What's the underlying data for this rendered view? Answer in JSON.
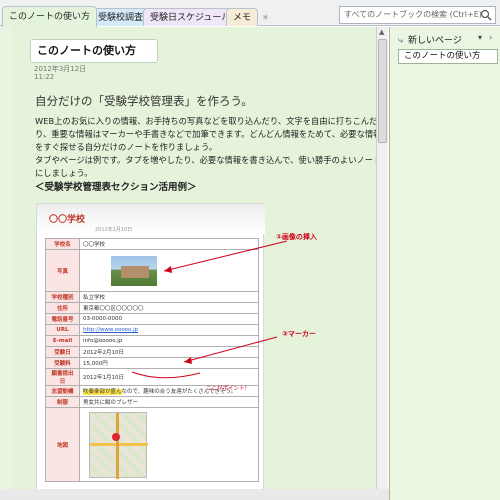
{
  "tabs": [
    {
      "label": "このノートの使い方",
      "active": true
    },
    {
      "label": "受験校調査",
      "active": false
    },
    {
      "label": "受験日スケジュール",
      "active": false
    },
    {
      "label": "メモ",
      "active": false
    }
  ],
  "search": {
    "placeholder": "すべてのノートブックの検索 (Ctrl+E)"
  },
  "page": {
    "title": "このノートの使い方",
    "date": "2012年3月12日",
    "time": "11:22",
    "heading": "自分だけの「受験学校管理表」を作ろう。",
    "paragraph1": "WEB上のお気に入りの情報、お手持ちの写真などを取り込んだり、文字を自由に打ちこんだり、重要な情報はマーカーや手書きなどで加筆できます。どんどん情報をためて、必要な情報をすぐ探せる自分だけのノートを作りましょう。",
    "paragraph2": "タブやページは例です。タブを増やしたり、必要な情報を書き込んで、使い勝手のよいノートにしましょう。",
    "subheading": "＜受験学校管理表セクション活用例＞"
  },
  "example_sheet": {
    "title": "〇〇学校",
    "subtitle": "2012年1月10日",
    "rows": [
      {
        "key": "学校名",
        "value": "〇〇学校"
      },
      {
        "key": "写真",
        "value": ""
      },
      {
        "key": "学校種別",
        "value": "私立学校"
      },
      {
        "key": "住所",
        "value": "東京都〇〇区〇〇〇〇〇"
      },
      {
        "key": "電話番号",
        "value": "03-0000-0000"
      },
      {
        "key": "URL",
        "value": "http://www.ooooo.jp"
      },
      {
        "key": "E-mail",
        "value": "info@ooooo.jp"
      },
      {
        "key": "受験日",
        "value": "2012年2月10日"
      },
      {
        "key": "受験料",
        "value": "15,000円"
      },
      {
        "key": "願書提出日",
        "value": "2012年1月10日"
      },
      {
        "key": "志望動機",
        "value_highlight": "吹奏楽部が盛ん",
        "value_rest": "なので、趣味の合う友達がたくさんできそう。"
      },
      {
        "key": "制服",
        "value": "男女共に紺のブレザー"
      },
      {
        "key": "地図",
        "value": ""
      }
    ],
    "annotations": {
      "image_insert": "①画像の挿入",
      "marker": "②マーカー",
      "point": "ここがポイント！"
    }
  },
  "side_panel": {
    "new_page": "新しいページ",
    "pages": [
      "このノートの使い方"
    ]
  },
  "colors": {
    "active_tab": "#e4f4dc",
    "page_bg": "#e4f3da",
    "annotation": "#d0021b",
    "highlight": "#ffe84a"
  },
  "icons": [
    "search-icon",
    "add-tab-icon",
    "new-page-icon",
    "dropdown-arrow-icon",
    "scroll-up-icon"
  ]
}
